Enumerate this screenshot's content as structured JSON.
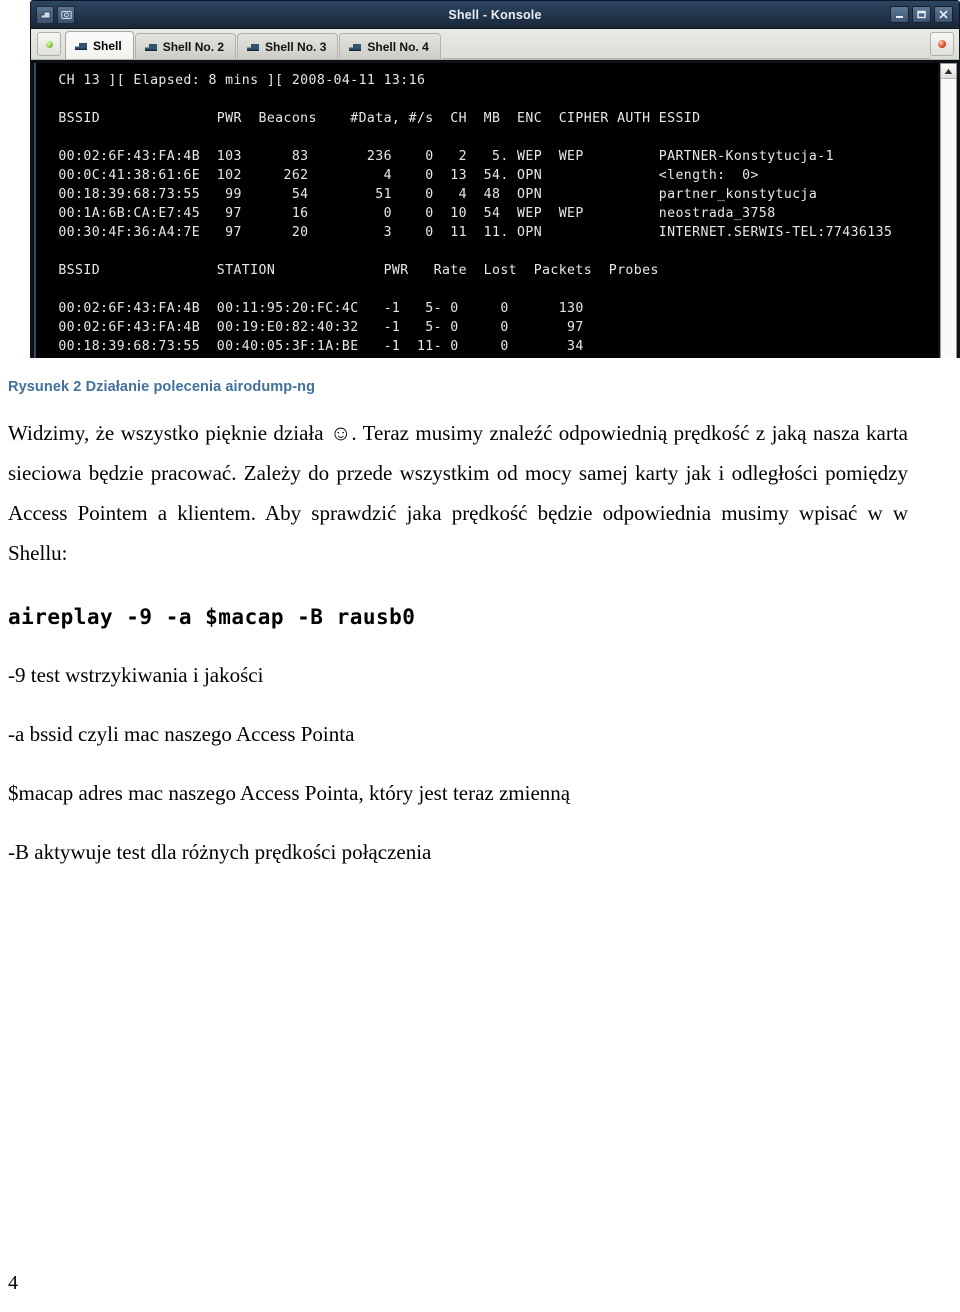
{
  "figure": {
    "window": {
      "title": "Shell - Konsole",
      "left_icons": [
        "window-menu-icon",
        "screenshot-icon"
      ],
      "controls": [
        {
          "name": "minimize-button",
          "glyph": "minimize-icon"
        },
        {
          "name": "maximize-button",
          "glyph": "maximize-icon"
        },
        {
          "name": "close-button",
          "glyph": "close-icon"
        }
      ]
    },
    "tabbar": {
      "new_tab_label": "",
      "tabs": [
        {
          "label": "Shell",
          "active": true
        },
        {
          "label": "Shell No. 2",
          "active": false
        },
        {
          "label": "Shell No. 3",
          "active": false
        },
        {
          "label": "Shell No. 4",
          "active": false
        }
      ]
    },
    "terminal": {
      "status_line": " CH 13 ][ Elapsed: 8 mins ][ 2008-04-11 13:16",
      "ap_header": " BSSID              PWR  Beacons    #Data, #/s  CH  MB  ENC  CIPHER AUTH ESSID",
      "ap_rows": [
        " 00:02:6F:43:FA:4B  103      83       236    0   2   5. WEP  WEP         PARTNER-Konstytucja-1",
        " 00:0C:41:38:61:6E  102     262         4    0  13  54. OPN              <length:  0>",
        " 00:18:39:68:73:55   99      54        51    0   4  48  OPN              partner_konstytucja",
        " 00:1A:6B:CA:E7:45   97      16         0    0  10  54  WEP  WEP         neostrada_3758",
        " 00:30:4F:36:A4:7E   97      20         3    0  11  11. OPN              INTERNET.SERWIS-TEL:77436135"
      ],
      "sta_header": " BSSID              STATION             PWR   Rate  Lost  Packets  Probes",
      "sta_rows": [
        " 00:02:6F:43:FA:4B  00:11:95:20:FC:4C   -1   5- 0     0      130",
        " 00:02:6F:43:FA:4B  00:19:E0:82:40:32   -1   5- 0     0       97",
        " 00:18:39:68:73:55  00:40:05:3F:1A:BE   -1  11- 0     0       34"
      ],
      "background_color": "#000000",
      "text_color": "#e8e8e8"
    }
  },
  "document": {
    "caption": "Rysunek 2 Działanie polecenia airodump-ng",
    "paragraph_1": "Widzimy, że wszystko pięknie działa ☺.  Teraz musimy znaleźć odpowiednią prędkość z jaką nasza karta sieciowa będzie pracować. Zależy do przede wszystkim od mocy samej karty jak i odległości pomiędzy Access Pointem a klientem. Aby sprawdzić jaka prędkość będzie odpowiednia musimy wpisać w w Shellu:",
    "command": "aireplay -9 -a $macap -B rausb0",
    "notes": [
      "-9  test wstrzykiwania i jakości",
      "-a bssid czyli mac naszego Access Pointa",
      "$macap adres mac naszego Access Pointa, który jest teraz zmienną",
      "-B aktywuje test dla różnych prędkości połączenia"
    ],
    "page_number": "4",
    "caption_color": "#41719C"
  }
}
